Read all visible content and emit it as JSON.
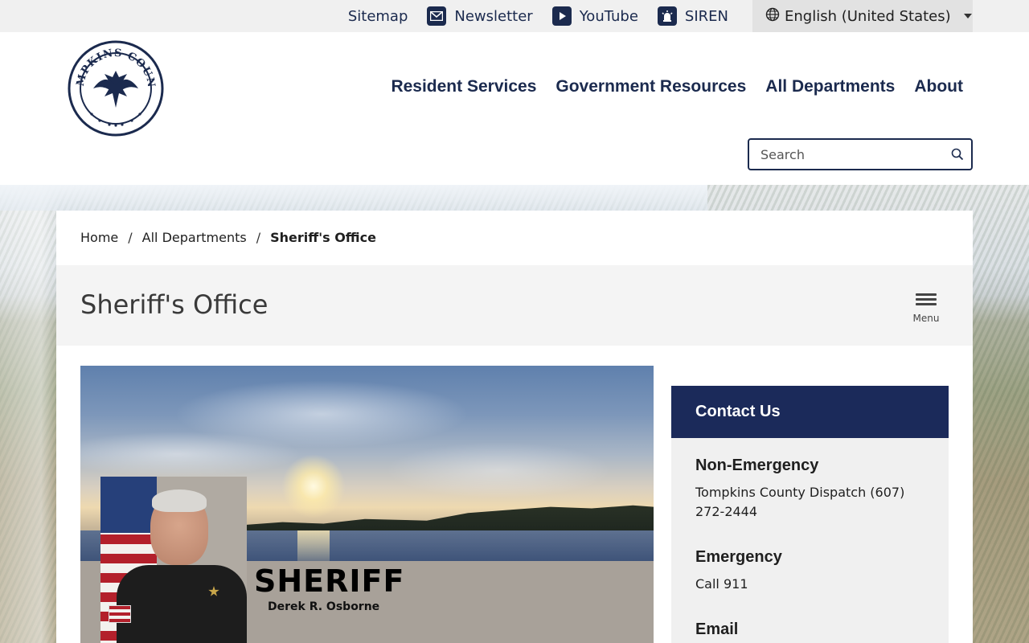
{
  "utility": {
    "links": [
      {
        "label": "Sitemap",
        "icon": "none"
      },
      {
        "label": "Newsletter",
        "icon": "envelope-icon"
      },
      {
        "label": "YouTube",
        "icon": "youtube-icon"
      },
      {
        "label": "SIREN",
        "icon": "siren-icon"
      }
    ],
    "language": "English (United States)"
  },
  "header": {
    "logo_alt": "TOMPKINS COUNTY",
    "nav": [
      "Resident Services",
      "Government Resources",
      "All Departments",
      "About"
    ],
    "search_placeholder": "Search"
  },
  "breadcrumb": {
    "items": [
      "Home",
      "All Departments"
    ],
    "current": "Sheriff's Office",
    "separator": "/"
  },
  "page": {
    "title": "Sheriff's Office",
    "menu_label": "Menu"
  },
  "hero": {
    "title": "SHERIFF",
    "subtitle": "Derek R. Osborne"
  },
  "contact": {
    "title": "Contact Us",
    "sections": [
      {
        "heading": "Non-Emergency",
        "text": "Tompkins County Dispatch (607) 272-2444"
      },
      {
        "heading": "Emergency",
        "text": "Call 911"
      },
      {
        "heading": "Email",
        "text": ""
      }
    ]
  },
  "colors": {
    "navy": "#1b2a4e",
    "contact_header": "#1b2a5a",
    "utility_bg": "#f0f0f0"
  }
}
